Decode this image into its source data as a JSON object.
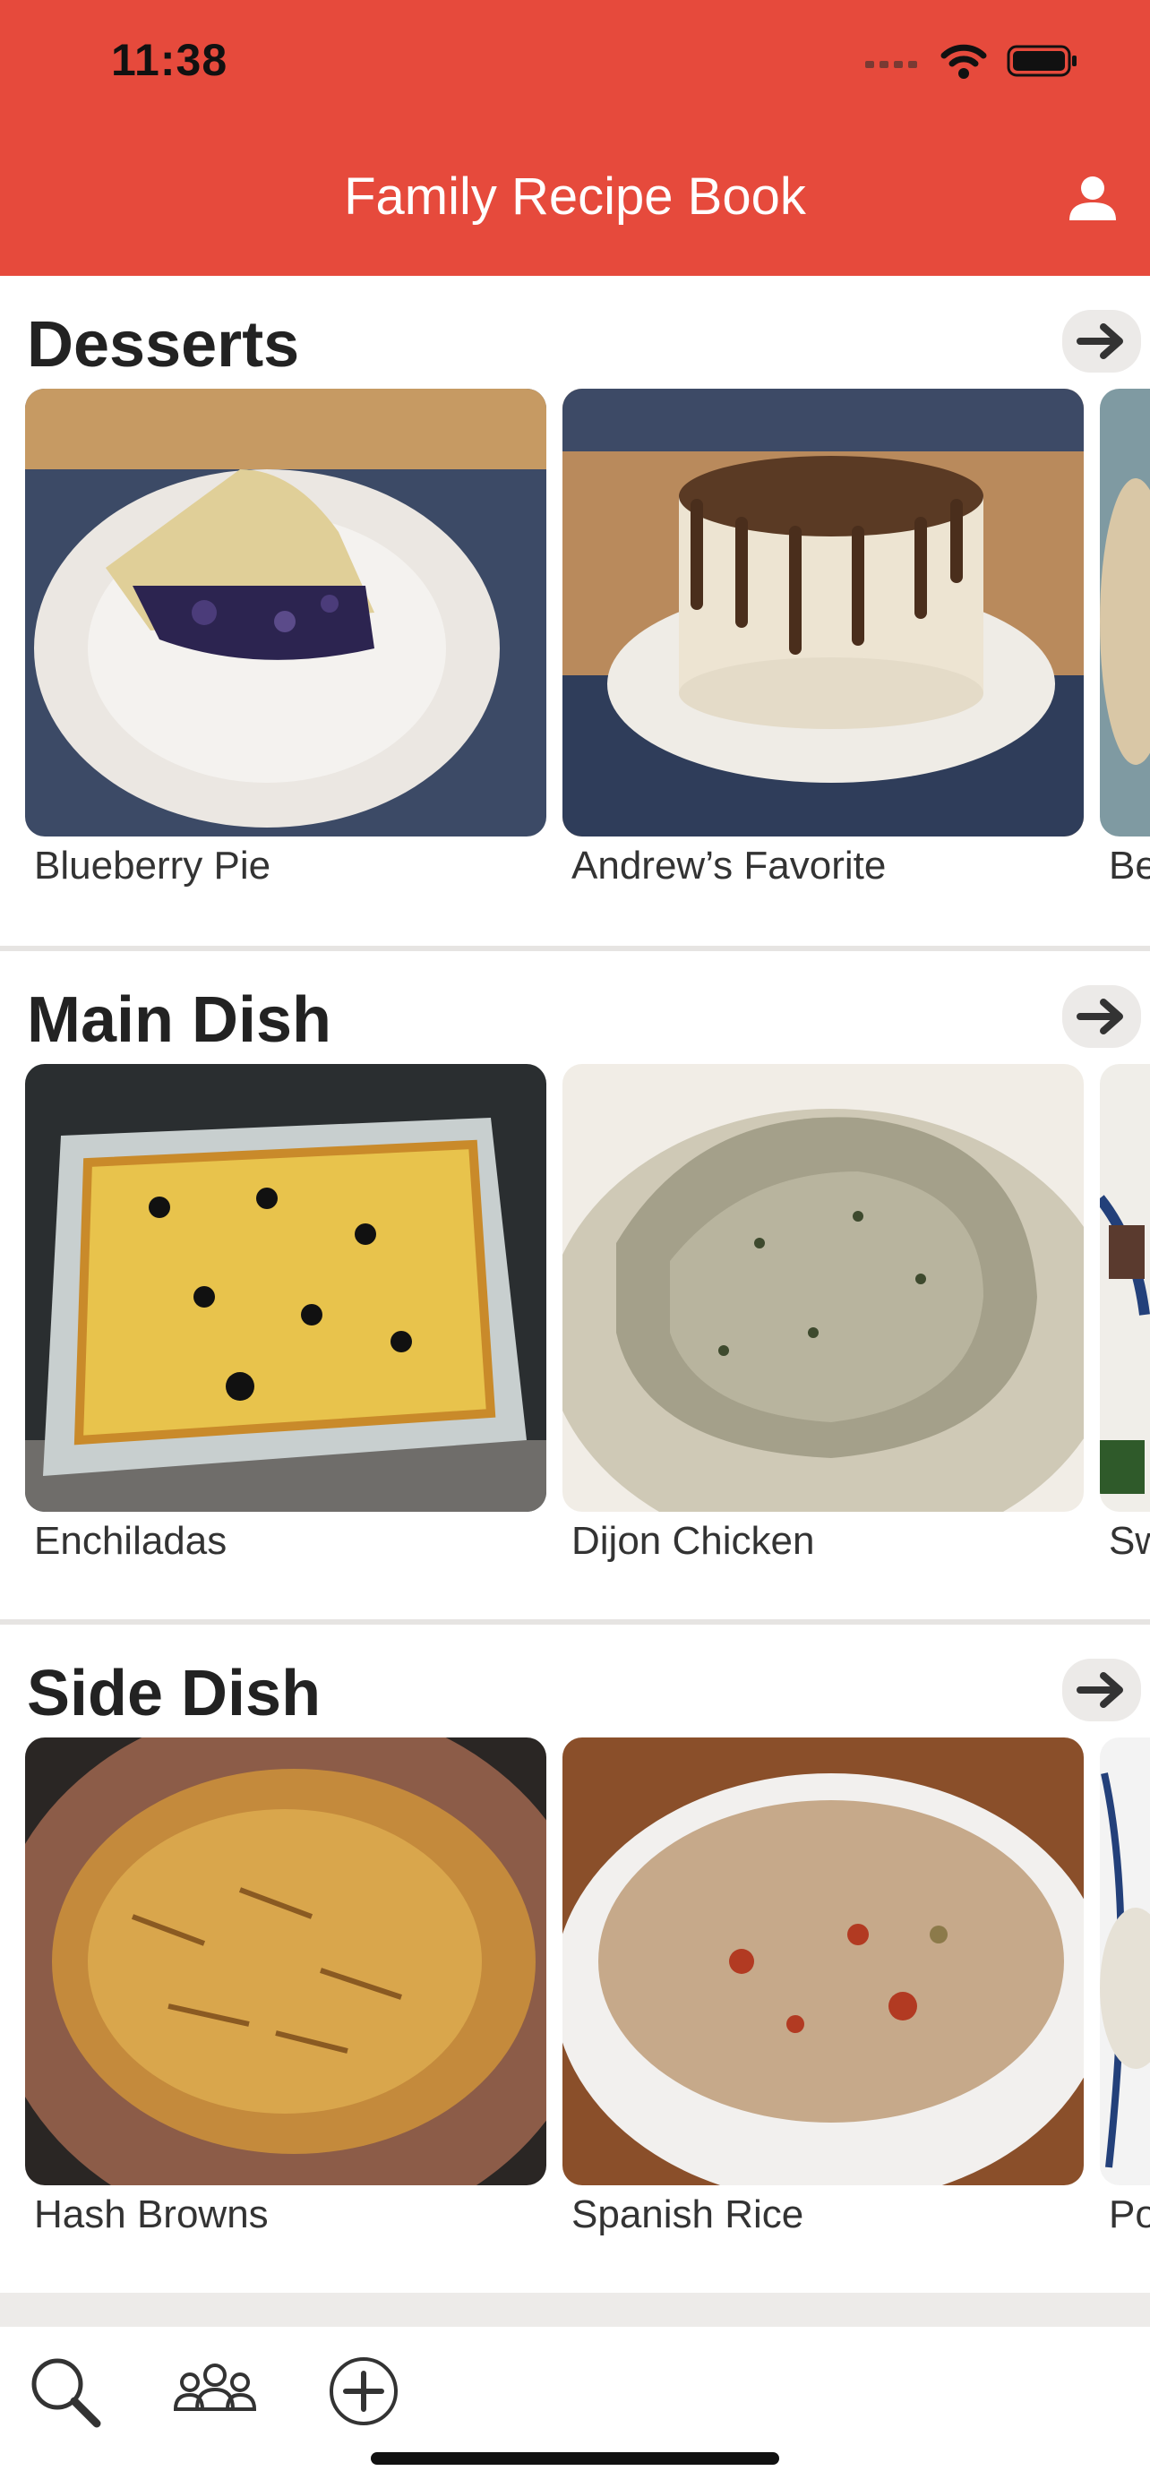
{
  "status_bar": {
    "time": "11:38"
  },
  "header": {
    "title": "Family Recipe Book",
    "profile_icon": "person-icon"
  },
  "colors": {
    "header_bg": "#E64A3C",
    "divider": "#E6E4E2",
    "arrow_bg": "#ECEAE8"
  },
  "sections": [
    {
      "title": "Desserts",
      "arrow_icon": "arrow-right-icon",
      "cards": [
        {
          "label": "Blueberry Pie"
        },
        {
          "label": "Andrew’s Favorite"
        },
        {
          "label": "Be"
        }
      ]
    },
    {
      "title": "Main Dish",
      "arrow_icon": "arrow-right-icon",
      "cards": [
        {
          "label": "Enchiladas"
        },
        {
          "label": "Dijon Chicken"
        },
        {
          "label": "Sw"
        }
      ]
    },
    {
      "title": "Side Dish",
      "arrow_icon": "arrow-right-icon",
      "cards": [
        {
          "label": "Hash Browns"
        },
        {
          "label": "Spanish Rice"
        },
        {
          "label": "Po"
        }
      ]
    }
  ],
  "tabbar": {
    "items": [
      {
        "icon": "search-icon"
      },
      {
        "icon": "family-icon"
      },
      {
        "icon": "add-circle-icon"
      }
    ]
  }
}
